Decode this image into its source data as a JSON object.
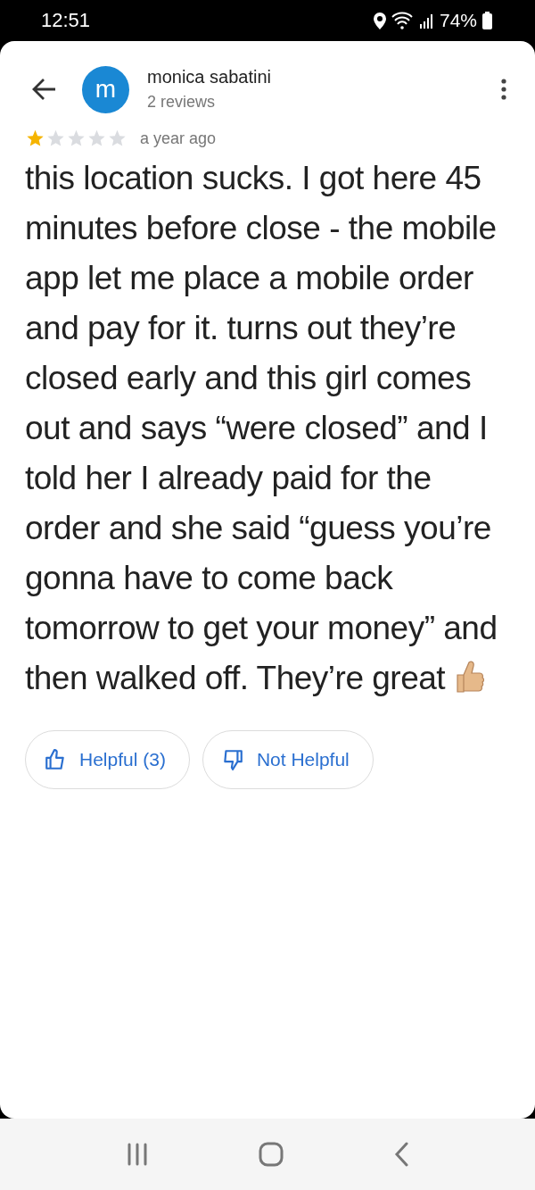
{
  "status_bar": {
    "time": "12:51",
    "battery": "74%"
  },
  "reviewer": {
    "initial": "m",
    "name": "monica sabatini",
    "reviews": "2 reviews"
  },
  "review": {
    "stars": 1,
    "time": "a year ago",
    "text": "this location sucks. I got here 45 minutes before close - the mobile app let me place a mobile order and pay for it. turns out they’re closed early and this girl comes out and says “were closed” and I told her I already paid for the order and she said “guess you’re gonna have to come back tomorrow to get your money” and then walked off. They’re great"
  },
  "buttons": [
    {
      "kind": "up",
      "label": "Helpful (3)"
    },
    {
      "kind": "down",
      "label": "Not Helpful"
    }
  ]
}
